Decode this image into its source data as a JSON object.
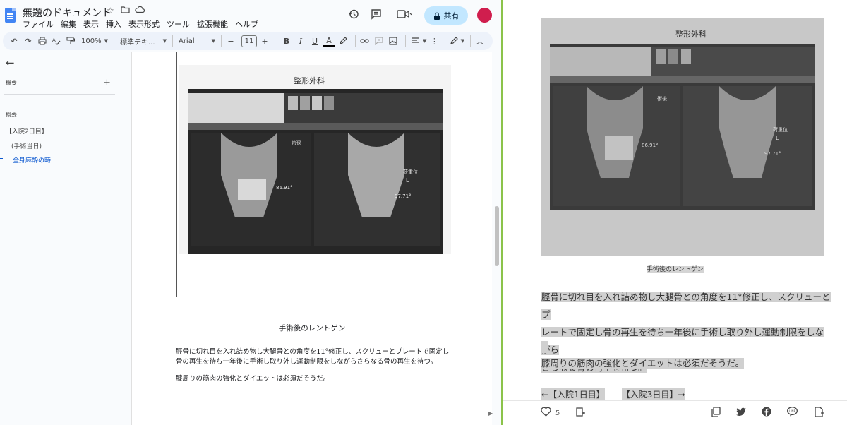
{
  "docs": {
    "title": "無題のドキュメント",
    "menu": [
      "ファイル",
      "編集",
      "表示",
      "挿入",
      "表示形式",
      "ツール",
      "拡張機能",
      "ヘルプ"
    ],
    "share_label": "共有",
    "toolbar": {
      "zoom": "100%",
      "style": "標準テキ...",
      "font": "Arial",
      "font_size": "11"
    },
    "outline": {
      "header": "概要",
      "section_label": "概要",
      "items": [
        "【入院2日目】",
        "(手術当日)",
        "全身麻酔の時"
      ]
    },
    "xray_header": "整形外科",
    "xray_labels": {
      "post_op": "術後",
      "angle1": "86.91°",
      "load": "荷重位",
      "side": "L",
      "angle2": "97.71°"
    },
    "caption": "手術後のレントゲン",
    "paragraph1_line1": "脛骨に切れ目を入れ詰め物し大腿骨との角度を11°修正し、スクリューとプレートで固定し",
    "paragraph1_line2": "骨の再生を待ち一年後に手術し取り外し運動制限をしながらさらなる骨の再生を待つ。",
    "paragraph2": "膝周りの筋肉の強化とダイエットは必須だそうだ。"
  },
  "article": {
    "caption": "手術後のレントゲン",
    "paragraph1_line1": "脛骨に切れ目を入れ詰め物し大腿骨との角度を11°修正し、スクリューとプ",
    "paragraph1_line2": "レートで固定し骨の再生を待ち一年後に手術し取り外し運動制限をしながら",
    "paragraph1_line3": "さらなる骨の再生を待つ。",
    "paragraph2": "膝周りの筋肉の強化とダイエットは必須だそうだ。",
    "prev_link": "←【入院1日目】",
    "next_link": "【入院3日目】→",
    "like_count": "5"
  },
  "colors": {
    "docs_bg": "#f9fbfd",
    "toolbar_bg": "#edf2fa",
    "share_bg": "#c2e7ff",
    "avatar": "#d01e4e",
    "outline_active": "#0b57d0",
    "divider": "#8bc34a",
    "highlight": "#d0d0d0"
  }
}
